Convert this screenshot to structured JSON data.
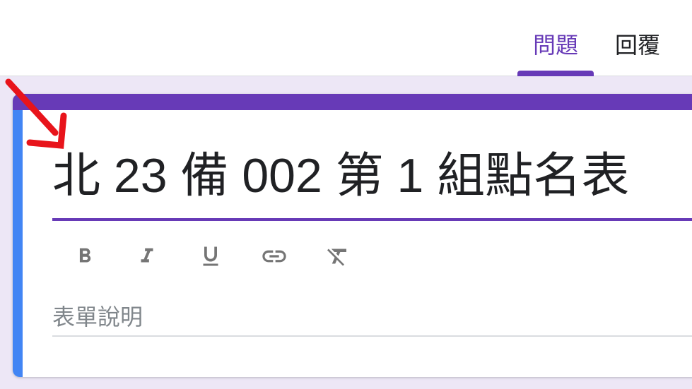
{
  "tabs": {
    "questions": "問題",
    "responses": "回覆"
  },
  "form": {
    "title": "北 23 備 002 第 1 組點名表",
    "description_placeholder": "表單說明"
  },
  "toolbar": {
    "buttons": [
      "bold-icon",
      "italic-icon",
      "underline-icon",
      "link-icon",
      "clear-format-icon"
    ]
  },
  "colors": {
    "accent": "#673ab7",
    "focus_bar": "#4285f4",
    "background": "#ede7f6",
    "annotation": "#e8141b"
  }
}
